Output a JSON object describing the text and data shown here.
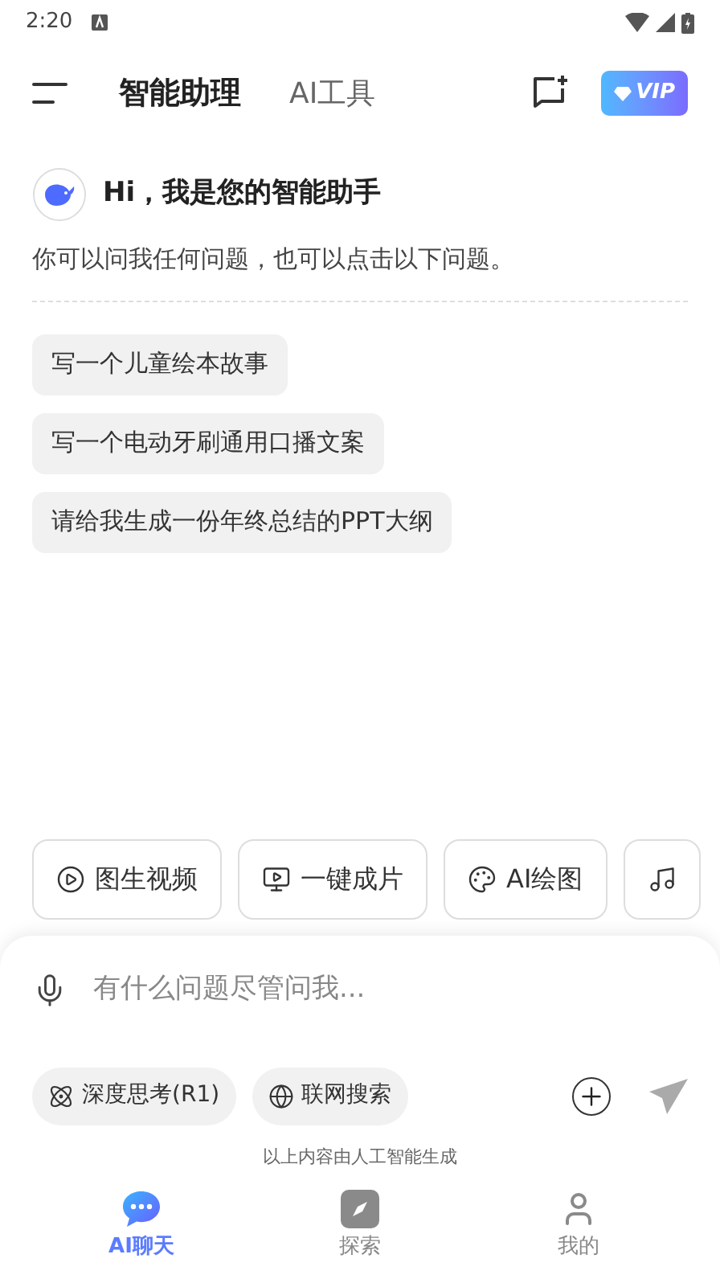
{
  "status_bar": {
    "time": "2:20"
  },
  "header": {
    "tabs": [
      {
        "label": "智能助理",
        "selected": true
      },
      {
        "label": "AI工具",
        "selected": false
      }
    ],
    "vip": "VIP"
  },
  "greeting": {
    "title": "Hi，我是您的智能助手",
    "subtitle": "你可以问我任何问题，也可以点击以下问题。"
  },
  "suggestions": [
    "写一个儿童绘本故事",
    "写一个电动牙刷通用口播文案",
    "请给我生成一份年终总结的PPT大纲"
  ],
  "tools": [
    {
      "kind": "video",
      "label": "图生视频"
    },
    {
      "kind": "film",
      "label": "一键成片"
    },
    {
      "kind": "paint",
      "label": "AI绘图"
    },
    {
      "kind": "music"
    }
  ],
  "input": {
    "placeholder": "有什么问题尽管问我..."
  },
  "options": [
    {
      "kind": "think",
      "label": "深度思考(R1)",
      "selected": false
    },
    {
      "kind": "web",
      "label": "联网搜索",
      "selected": false
    }
  ],
  "disclaimer": "以上内容由人工智能生成",
  "nav": [
    {
      "kind": "chat",
      "label": "AI聊天",
      "selected": true
    },
    {
      "kind": "explore",
      "label": "探索",
      "selected": false
    },
    {
      "kind": "me",
      "label": "我的",
      "selected": false
    }
  ]
}
